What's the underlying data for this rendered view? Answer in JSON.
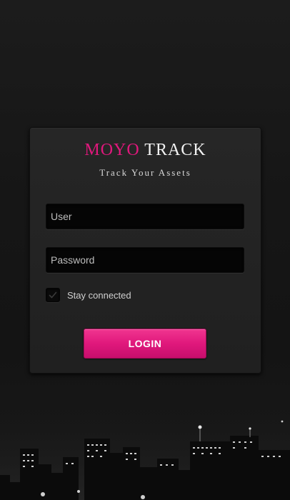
{
  "brand": {
    "name_part1": "MOYO",
    "name_part2": "TRACK",
    "tagline": "Track Your Assets",
    "accent_color": "#e0187c"
  },
  "form": {
    "user_placeholder": "User",
    "user_value": "",
    "password_placeholder": "Password",
    "password_value": "",
    "stay_connected_label": "Stay connected",
    "stay_connected_checked": true,
    "login_label": "LOGIN"
  },
  "icons": {
    "checkmark": "check-icon"
  },
  "colors": {
    "background": "#161616",
    "card": "#232323",
    "field": "#050505",
    "button": "#e0187c"
  }
}
